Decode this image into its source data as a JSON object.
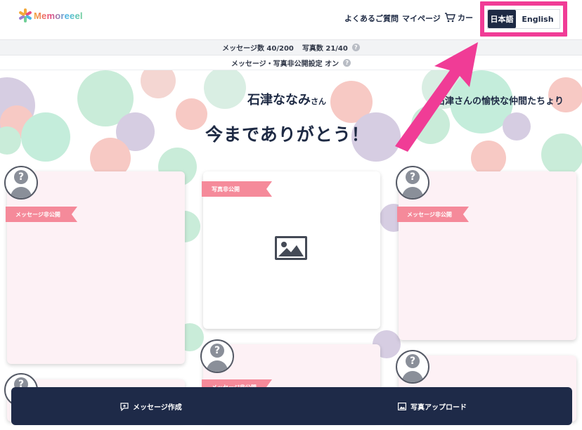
{
  "brand": {
    "logo_text": "Memoreeel",
    "logo_colors": [
      "#f3a93b",
      "#e84a7f",
      "#4bb7e6",
      "#6fcf97",
      "#9b7fd4"
    ]
  },
  "nav": {
    "faq": "よくあるご質問",
    "mypage": "マイページ",
    "cart": "カー"
  },
  "language": {
    "ja": "日本語",
    "en": "English",
    "highlight_color": "#f03c96"
  },
  "info": {
    "message_count": "メッセージ数 40/200",
    "photo_count": "写真数 21/40",
    "privacy_setting": "メッセージ・写真非公開設定 オン"
  },
  "board": {
    "recipient": "石津ななみ",
    "recipient_suffix": "さん",
    "sender": "石津さんの愉快な仲間たちょり",
    "headline": "今までありがとう！"
  },
  "cards": [
    {
      "ribbon": "メッセージ非公開"
    },
    {
      "ribbon": "写真非公開"
    },
    {
      "ribbon": "メッセージ非公開"
    },
    {
      "ribbon": "メッセージ非公開"
    }
  ],
  "actions": {
    "create_message": "メッセージ作成",
    "upload_photo": "写真アップロード"
  },
  "colors": {
    "navy": "#1e2a48",
    "ribbon": "#f58a9a",
    "card_pink": "#fdf1f5",
    "arrow": "#f03c96"
  }
}
